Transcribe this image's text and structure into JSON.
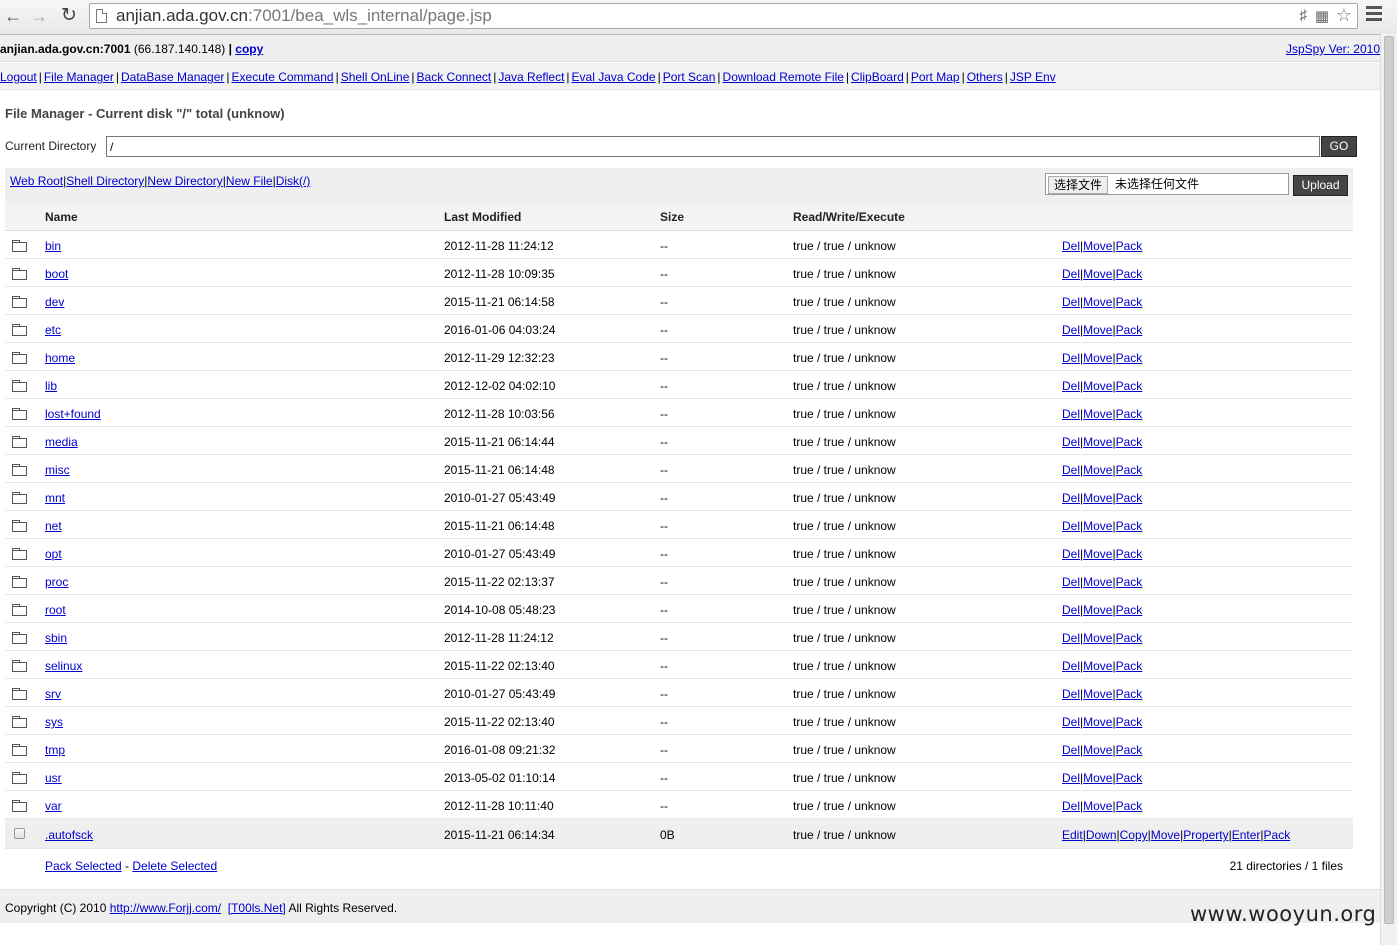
{
  "browser": {
    "url_host": "anjian.ada.gov.cn",
    "url_rest": ":7001/bea_wls_internal/page.jsp"
  },
  "header": {
    "host": "anjian.ada.gov.cn:7001",
    "ip": "(66.187.140.148)",
    "separator": " | ",
    "copy_label": "copy",
    "version": "JspSpy Ver: 2010"
  },
  "menu": [
    {
      "label": "Logout"
    },
    {
      "label": "File Manager"
    },
    {
      "label": "DataBase Manager"
    },
    {
      "label": "Execute Command"
    },
    {
      "label": "Shell OnLine"
    },
    {
      "label": "Back Connect"
    },
    {
      "label": "Java Reflect"
    },
    {
      "label": "Eval Java Code"
    },
    {
      "label": "Port Scan"
    },
    {
      "label": "Download Remote File"
    },
    {
      "label": "ClipBoard"
    },
    {
      "label": "Port Map"
    },
    {
      "label": "Others"
    },
    {
      "label": "JSP Env"
    }
  ],
  "file_manager": {
    "title": "File Manager - Current disk \"/\" total (unknow)",
    "current_dir_label": "Current Directory",
    "current_dir_value": "/",
    "go_label": "GO",
    "quick_links": [
      "Web Root",
      "Shell Directory",
      "New Directory",
      "New File",
      "Disk(/)"
    ],
    "choose_file_label": "选择文件",
    "no_file_text": "未选择任何文件",
    "upload_label": "Upload",
    "columns": {
      "name": "Name",
      "modified": "Last Modified",
      "size": "Size",
      "rwx": "Read/Write/Execute"
    },
    "directories": [
      {
        "name": "bin",
        "modified": "2012-11-28 11:24:12",
        "size": "--",
        "rwx": "true / true / unknow"
      },
      {
        "name": "boot",
        "modified": "2012-11-28 10:09:35",
        "size": "--",
        "rwx": "true / true / unknow"
      },
      {
        "name": "dev",
        "modified": "2015-11-21 06:14:58",
        "size": "--",
        "rwx": "true / true / unknow"
      },
      {
        "name": "etc",
        "modified": "2016-01-06 04:03:24",
        "size": "--",
        "rwx": "true / true / unknow"
      },
      {
        "name": "home",
        "modified": "2012-11-29 12:32:23",
        "size": "--",
        "rwx": "true / true / unknow"
      },
      {
        "name": "lib",
        "modified": "2012-12-02 04:02:10",
        "size": "--",
        "rwx": "true / true / unknow"
      },
      {
        "name": "lost+found",
        "modified": "2012-11-28 10:03:56",
        "size": "--",
        "rwx": "true / true / unknow"
      },
      {
        "name": "media",
        "modified": "2015-11-21 06:14:44",
        "size": "--",
        "rwx": "true / true / unknow"
      },
      {
        "name": "misc",
        "modified": "2015-11-21 06:14:48",
        "size": "--",
        "rwx": "true / true / unknow"
      },
      {
        "name": "mnt",
        "modified": "2010-01-27 05:43:49",
        "size": "--",
        "rwx": "true / true / unknow"
      },
      {
        "name": "net",
        "modified": "2015-11-21 06:14:48",
        "size": "--",
        "rwx": "true / true / unknow"
      },
      {
        "name": "opt",
        "modified": "2010-01-27 05:43:49",
        "size": "--",
        "rwx": "true / true / unknow"
      },
      {
        "name": "proc",
        "modified": "2015-11-22 02:13:37",
        "size": "--",
        "rwx": "true / true / unknow"
      },
      {
        "name": "root",
        "modified": "2014-10-08 05:48:23",
        "size": "--",
        "rwx": "true / true / unknow"
      },
      {
        "name": "sbin",
        "modified": "2012-11-28 11:24:12",
        "size": "--",
        "rwx": "true / true / unknow"
      },
      {
        "name": "selinux",
        "modified": "2015-11-22 02:13:40",
        "size": "--",
        "rwx": "true / true / unknow"
      },
      {
        "name": "srv",
        "modified": "2010-01-27 05:43:49",
        "size": "--",
        "rwx": "true / true / unknow"
      },
      {
        "name": "sys",
        "modified": "2015-11-22 02:13:40",
        "size": "--",
        "rwx": "true / true / unknow"
      },
      {
        "name": "tmp",
        "modified": "2016-01-08 09:21:32",
        "size": "--",
        "rwx": "true / true / unknow"
      },
      {
        "name": "usr",
        "modified": "2013-05-02 01:10:14",
        "size": "--",
        "rwx": "true / true / unknow"
      },
      {
        "name": "var",
        "modified": "2012-11-28 10:11:40",
        "size": "--",
        "rwx": "true / true / unknow"
      }
    ],
    "dir_actions": [
      "Del",
      "Move",
      "Pack"
    ],
    "files": [
      {
        "name": ".autofsck",
        "modified": "2015-11-21 06:14:34",
        "size": "0B",
        "rwx": "true / true / unknow"
      }
    ],
    "file_actions": [
      "Edit",
      "Down",
      "Copy",
      "Move",
      "Property",
      "Enter",
      "Pack"
    ],
    "pack_selected": "Pack Selected",
    "dash": " - ",
    "delete_selected": "Delete Selected",
    "summary": "21 directories / 1 files"
  },
  "footer": {
    "prefix": "Copyright (C) 2010 ",
    "link1": "http://www.Forjj.com/",
    "link2": "[T00ls.Net]",
    "suffix": " All Rights Reserved."
  },
  "watermark": "www.wooyun.org",
  "icons": {
    "back": "arrow-left-icon",
    "forward": "arrow-right-icon",
    "reload": "reload-icon",
    "folder": "folder-icon",
    "star": "star-icon",
    "menu": "hamburger-menu-icon"
  }
}
